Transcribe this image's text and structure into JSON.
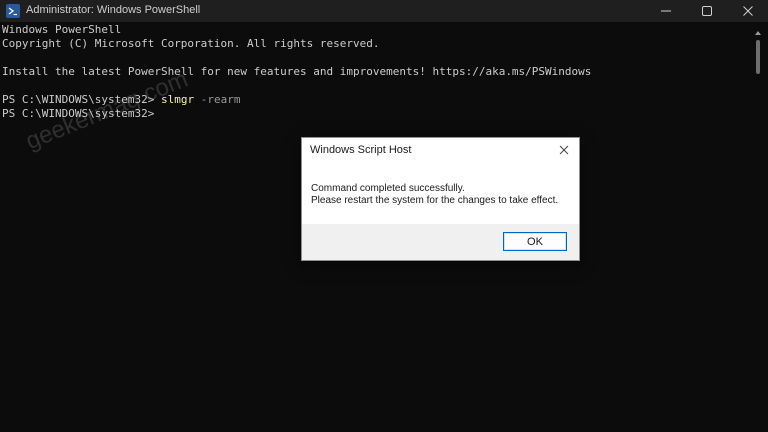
{
  "window": {
    "title": "Administrator: Windows PowerShell",
    "background": "#0c0c0c",
    "icon": "powershell-icon"
  },
  "controls": {
    "minimize_icon": "minimize-icon",
    "maximize_icon": "maximize-icon",
    "close_icon": "close-icon"
  },
  "terminal": {
    "line1": "Windows PowerShell",
    "line2": "Copyright (C) Microsoft Corporation. All rights reserved.",
    "line3": "Install the latest PowerShell for new features and improvements! https://aka.ms/PSWindows",
    "prompt1": "PS C:\\WINDOWS\\system32> ",
    "command": "slmgr",
    "argument": " -rearm",
    "prompt2": "PS C:\\WINDOWS\\system32>"
  },
  "dialog": {
    "title": "Windows Script Host",
    "message_line1": "Command completed successfully.",
    "message_line2": "Please restart the system for the changes to take effect.",
    "ok_label": "OK"
  },
  "watermarks": {
    "text": "geekermag.com"
  }
}
